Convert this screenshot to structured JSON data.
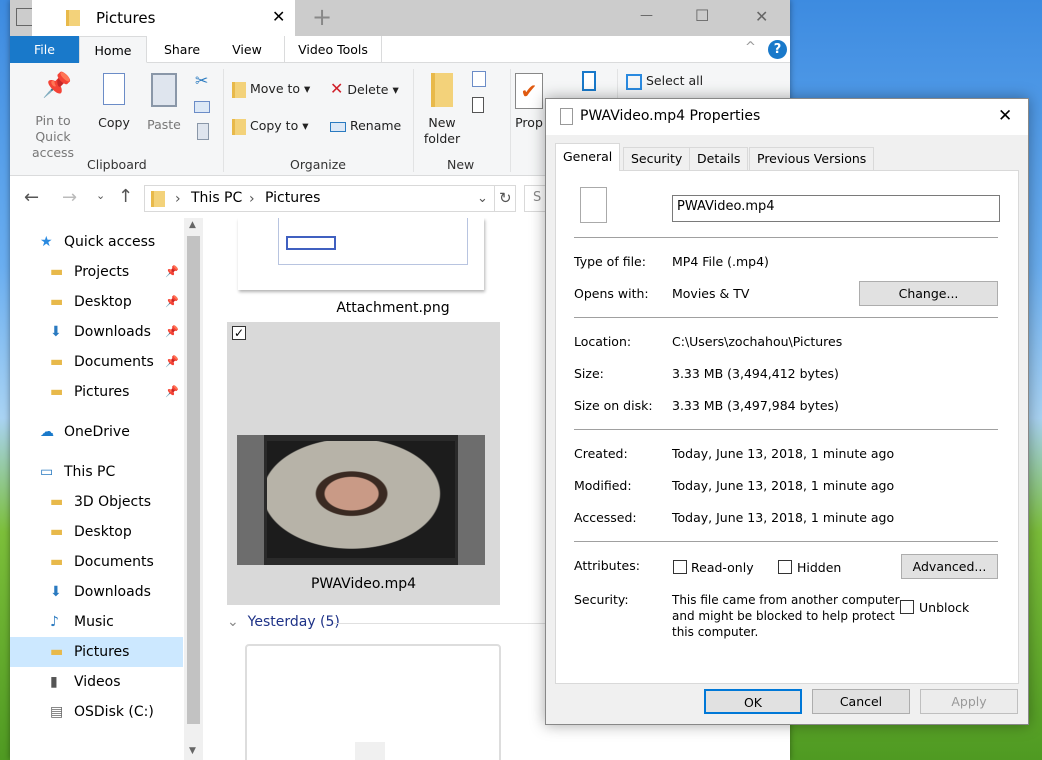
{
  "window": {
    "tab_title": "Pictures",
    "new_tab": "+",
    "minimize": "—",
    "maximize": "☐",
    "close": "✕"
  },
  "ribbon": {
    "tabs": [
      "File",
      "Home",
      "Share",
      "View",
      "Video Tools"
    ],
    "collapse": "^",
    "help": "?",
    "clipboard": {
      "pin": "Pin to Quick",
      "pin2": "access",
      "copy": "Copy",
      "paste": "Paste",
      "group": "Clipboard"
    },
    "organize": {
      "move_to": "Move to",
      "copy_to": "Copy to",
      "delete": "Delete",
      "rename": "Rename",
      "group": "Organize"
    },
    "new": {
      "new_folder": "New",
      "new_folder2": "folder",
      "group": "New"
    },
    "open": {
      "properties": "Prop"
    },
    "select": {
      "select_all": "Select all"
    }
  },
  "address": {
    "path": [
      "This PC",
      "Pictures"
    ],
    "search_placeholder": "S"
  },
  "nav": {
    "items": [
      {
        "label": "Quick access",
        "icon": "star",
        "pinned": false,
        "indent": 0
      },
      {
        "label": "Projects",
        "icon": "folder",
        "pinned": true,
        "indent": 1
      },
      {
        "label": "Desktop",
        "icon": "folder",
        "pinned": true,
        "indent": 1
      },
      {
        "label": "Downloads",
        "icon": "download",
        "pinned": true,
        "indent": 1
      },
      {
        "label": "Documents",
        "icon": "folder",
        "pinned": true,
        "indent": 1
      },
      {
        "label": "Pictures",
        "icon": "folder",
        "pinned": true,
        "indent": 1
      },
      {
        "label": "OneDrive",
        "icon": "cloud",
        "pinned": false,
        "indent": 0
      },
      {
        "label": "This PC",
        "icon": "pc",
        "pinned": false,
        "indent": 0
      },
      {
        "label": "3D Objects",
        "icon": "folder",
        "pinned": false,
        "indent": 1
      },
      {
        "label": "Desktop",
        "icon": "folder",
        "pinned": false,
        "indent": 1
      },
      {
        "label": "Documents",
        "icon": "folder",
        "pinned": false,
        "indent": 1
      },
      {
        "label": "Downloads",
        "icon": "download",
        "pinned": false,
        "indent": 1
      },
      {
        "label": "Music",
        "icon": "music",
        "pinned": false,
        "indent": 1
      },
      {
        "label": "Pictures",
        "icon": "folder",
        "pinned": false,
        "indent": 1,
        "selected": true
      },
      {
        "label": "Videos",
        "icon": "film",
        "pinned": false,
        "indent": 1
      },
      {
        "label": "OSDisk (C:)",
        "icon": "disk",
        "pinned": false,
        "indent": 1
      }
    ]
  },
  "files": {
    "attachment": "Attachment.png",
    "video": "PWAVideo.mp4",
    "group": "Yesterday (5)"
  },
  "dialog": {
    "title": "PWAVideo.mp4 Properties",
    "tabs": [
      "General",
      "Security",
      "Details",
      "Previous Versions"
    ],
    "filename": "PWAVideo.mp4",
    "type_label": "Type of file:",
    "type": "MP4 File (.mp4)",
    "opens_label": "Opens with:",
    "opens": "Movies & TV",
    "change": "Change...",
    "location_label": "Location:",
    "location": "C:\\Users\\zochahou\\Pictures",
    "size_label": "Size:",
    "size": "3.33 MB (3,494,412 bytes)",
    "disk_label": "Size on disk:",
    "disk": "3.33 MB (3,497,984 bytes)",
    "created_label": "Created:",
    "created": "Today, June 13, 2018, 1 minute ago",
    "modified_label": "Modified:",
    "modified": "Today, June 13, 2018, 1 minute ago",
    "accessed_label": "Accessed:",
    "accessed": "Today, June 13, 2018, 1 minute ago",
    "attr_label": "Attributes:",
    "readonly": "Read-only",
    "hidden": "Hidden",
    "advanced": "Advanced...",
    "security_label": "Security:",
    "security_1": "This file came from another computer",
    "security_2": "and might be blocked to help protect",
    "security_3": "this computer.",
    "unblock": "Unblock",
    "ok": "OK",
    "cancel": "Cancel",
    "apply": "Apply"
  }
}
